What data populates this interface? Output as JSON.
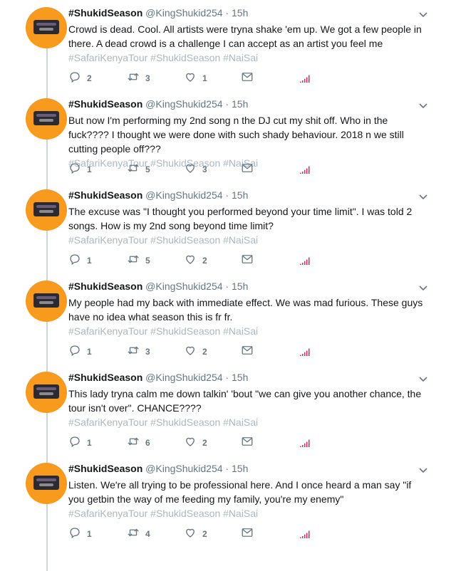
{
  "tweets": [
    {
      "name": "#ShukidSeason",
      "handle": "@KingShukid254",
      "dot": "·",
      "time": "15h",
      "text": "Crowd is dead. Cool. All artists were tryna shake 'em up. We got a few people in there. A dead crowd is a challenge I can accept as an artist you feel me",
      "tags": "#SafariKenyaTour #ShukidSeason #NaiSai",
      "replies": "2",
      "retweets": "3",
      "likes": "1"
    },
    {
      "name": "#ShukidSeason",
      "handle": "@KingShukid254",
      "dot": "·",
      "time": "15h",
      "text": "But now I'm performing my 2nd song n the DJ cut my shit off. Who in the fuck???? I thought we were done with such shady behaviour. 2018 n we still cutting people off???",
      "tags": "#SafariKenyaTour #ShukidSeason #NaiSai",
      "replies": "1",
      "retweets": "5",
      "likes": "3"
    },
    {
      "name": "#ShukidSeason",
      "handle": "@KingShukid254",
      "dot": "·",
      "time": "15h",
      "text": "The excuse was \"I thought you performed beyond your time limit\". I was told 2 songs. How is my 2nd song beyond time limit?",
      "tags": "#SafariKenyaTour #ShukidSeason #NaiSai",
      "replies": "1",
      "retweets": "5",
      "likes": "2"
    },
    {
      "name": "#ShukidSeason",
      "handle": "@KingShukid254",
      "dot": "·",
      "time": "15h",
      "text": "My people had my back with immediate effect. We was mad furious. These guys have no idea what season this is fr fr.",
      "tags": "#SafariKenyaTour #ShukidSeason #NaiSai",
      "replies": "1",
      "retweets": "3",
      "likes": "2"
    },
    {
      "name": "#ShukidSeason",
      "handle": "@KingShukid254",
      "dot": "·",
      "time": "15h",
      "text": "This lady tryna calm me down talkin' 'bout \"we can give you another chance, the tour isn't over\". CHANCE????",
      "tags": "#SafariKenyaTour #ShukidSeason #NaiSai",
      "replies": "1",
      "retweets": "6",
      "likes": "2"
    },
    {
      "name": "#ShukidSeason",
      "handle": "@KingShukid254",
      "dot": "·",
      "time": "15h",
      "text": "Listen. We're all trying to be professional here. And I once heard a man say \"if you getbin the way of me feeding my family, you're my enemy\"",
      "tags": "#SafariKenyaTour #ShukidSeason #NaiSai",
      "replies": "1",
      "retweets": "4",
      "likes": "2"
    }
  ],
  "colors": {
    "text": "#14171a",
    "muted": "#657786",
    "hashtag": "#aab8c2",
    "thread_line": "#ccd6dd",
    "avatar_bg": "#f79a1d",
    "analytics": "#e0245e"
  },
  "icons": {
    "reply": "reply-icon",
    "retweet": "retweet-icon",
    "like": "heart-icon",
    "dm": "envelope-icon",
    "analytics": "analytics-icon",
    "menu": "chevron-down-icon"
  }
}
